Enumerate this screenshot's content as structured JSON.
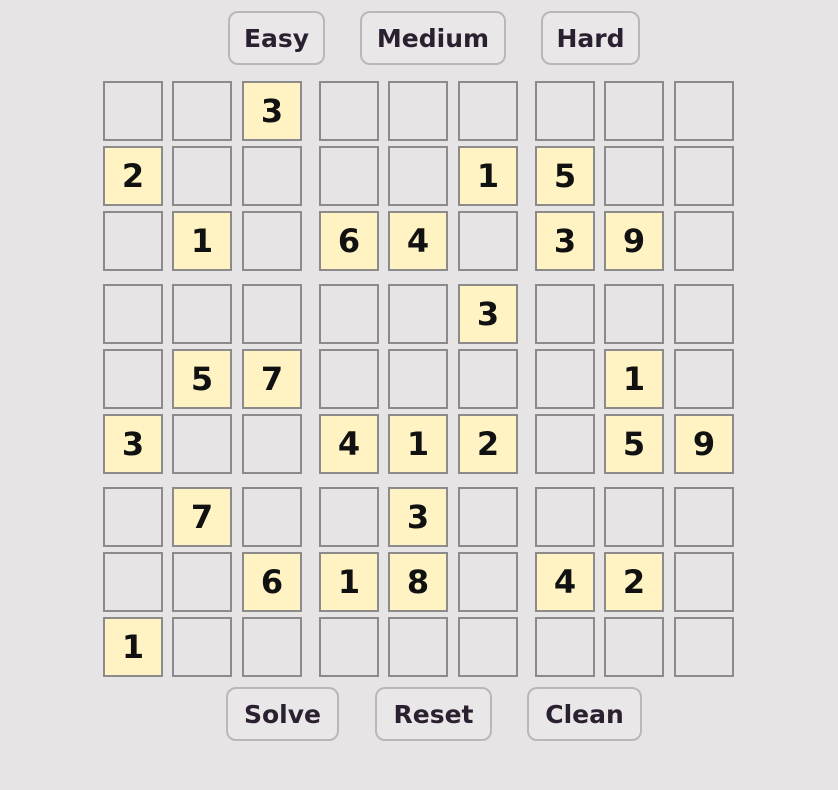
{
  "difficulty": {
    "easy_label": "Easy",
    "medium_label": "Medium",
    "hard_label": "Hard"
  },
  "actions": {
    "solve_label": "Solve",
    "reset_label": "Reset",
    "clean_label": "Clean"
  },
  "colors": {
    "background": "#e6e4e5",
    "given_cell": "#fff3c4",
    "cell_border": "#8c8a8b",
    "button_text": "#2b2030"
  },
  "board": [
    [
      "",
      "",
      "3",
      "",
      "",
      "",
      "",
      "",
      ""
    ],
    [
      "2",
      "",
      "",
      "",
      "",
      "1",
      "5",
      "",
      ""
    ],
    [
      "",
      "1",
      "",
      "6",
      "4",
      "",
      "3",
      "9",
      ""
    ],
    [
      "",
      "",
      "",
      "",
      "",
      "3",
      "",
      "",
      ""
    ],
    [
      "",
      "5",
      "7",
      "",
      "",
      "",
      "",
      "1",
      ""
    ],
    [
      "3",
      "",
      "",
      "4",
      "1",
      "2",
      "",
      "5",
      "9"
    ],
    [
      "",
      "7",
      "",
      "",
      "3",
      "",
      "",
      "",
      ""
    ],
    [
      "",
      "",
      "6",
      "1",
      "8",
      "",
      "4",
      "2",
      ""
    ],
    [
      "1",
      "",
      "",
      "",
      "",
      "",
      "",
      "",
      ""
    ]
  ]
}
